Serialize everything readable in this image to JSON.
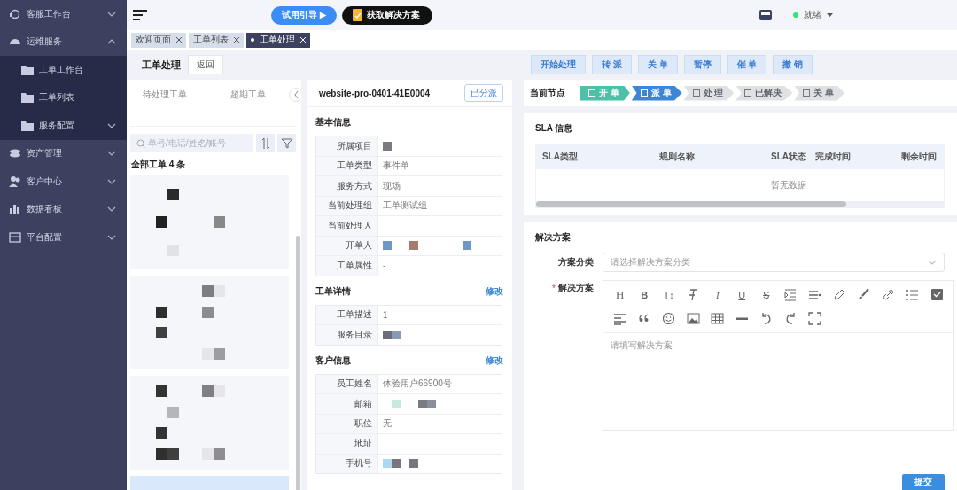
{
  "sidebar": {
    "items": [
      {
        "label": "客服工作台",
        "expanded": false
      },
      {
        "label": "运维服务",
        "expanded": true,
        "children": [
          {
            "label": "工单工作台"
          },
          {
            "label": "工单列表"
          },
          {
            "label": "服务配置",
            "expanded": false
          }
        ]
      },
      {
        "label": "资产管理",
        "expanded": false
      },
      {
        "label": "客户中心",
        "expanded": false
      },
      {
        "label": "数据看板",
        "expanded": false
      },
      {
        "label": "平台配置",
        "expanded": false
      }
    ]
  },
  "topbar": {
    "guide_button": "试用引导 ▶",
    "solution_button": "获取解决方案",
    "status": {
      "label": "就绪",
      "color": "#2ee86f"
    }
  },
  "page_tabs": [
    {
      "label": "欢迎页面",
      "selected": false
    },
    {
      "label": "工单列表",
      "selected": false
    },
    {
      "label": "工单处理",
      "selected": true
    }
  ],
  "page_title": "工单处理",
  "back_button": "返回",
  "ticket_list": {
    "tabs": [
      {
        "label": "待处理工单",
        "selected": false
      },
      {
        "label": "超期工单",
        "selected": false
      }
    ],
    "search": {
      "placeholder": "单号/电话/姓名/账号"
    },
    "count_label": "全部工单 4 条",
    "cards": [
      {
        "selected": false
      },
      {
        "selected": false
      },
      {
        "selected": false
      },
      {
        "selected": true
      }
    ]
  },
  "ticket": {
    "number": "website-pro-0401-41E0004",
    "status_badge": "已分派",
    "sections": [
      {
        "title": "基本信息",
        "fields": [
          {
            "label": "所属项目",
            "redacted": true
          },
          {
            "label": "工单类型",
            "value": "事件单"
          },
          {
            "label": "服务方式",
            "value": "现场"
          },
          {
            "label": "当前处理组",
            "value": "工单测试组"
          },
          {
            "label": "当前处理人"
          },
          {
            "label": "开单人",
            "redacted": true
          },
          {
            "label": "工单属性",
            "value": "-"
          }
        ]
      },
      {
        "title": "工单详情",
        "action": "修改",
        "fields": [
          {
            "label": "工单描述",
            "value": "1"
          },
          {
            "label": "服务目录",
            "redacted": true
          }
        ]
      },
      {
        "title": "客户信息",
        "action": "修改",
        "fields": [
          {
            "label": "员工姓名",
            "value": "体验用户66900号"
          },
          {
            "label": "邮箱",
            "redacted": true
          },
          {
            "label": "职位",
            "value": "无"
          },
          {
            "label": "地址"
          },
          {
            "label": "手机号",
            "redacted": true
          }
        ]
      }
    ]
  },
  "actions": [
    "开始处理",
    "转 派",
    "关 单",
    "暂停",
    "催 单",
    "撤 销"
  ],
  "progress": {
    "label": "当前节点",
    "steps": [
      {
        "label": "开 单",
        "completed": true,
        "active": false
      },
      {
        "label": "派 单",
        "completed": false,
        "active": true
      },
      {
        "label": "处 理",
        "completed": false,
        "active": false
      },
      {
        "label": "已解决",
        "completed": false,
        "active": false
      },
      {
        "label": "关 单",
        "completed": false,
        "active": false
      }
    ]
  },
  "sla": {
    "title": "SLA 信息",
    "columns": [
      "SLA类型",
      "规则名称",
      "SLA状态",
      "完成时间",
      "剩余时间"
    ],
    "empty_text": "暂无数据"
  },
  "solution": {
    "title": "解决方案",
    "category_label": "方案分类",
    "category_placeholder": "请选择解决方案分类",
    "content_label": "解决方案",
    "required_mark": "*",
    "toolbar": [
      {
        "kind": "glyph",
        "text": "H"
      },
      {
        "kind": "glyph",
        "text": "B"
      },
      {
        "kind": "glyph",
        "text": "T↕"
      },
      {
        "kind": "clearformat"
      },
      {
        "kind": "glyph",
        "text": "I"
      },
      {
        "kind": "glyph",
        "text": "U"
      },
      {
        "kind": "glyph",
        "text": "S"
      },
      {
        "kind": "indent"
      },
      {
        "kind": "align"
      },
      {
        "kind": "pencil"
      },
      {
        "kind": "brush"
      },
      {
        "kind": "link"
      },
      {
        "kind": "list"
      },
      {
        "kind": "checkbox"
      },
      {
        "kind": "alignleft"
      },
      {
        "kind": "quote"
      },
      {
        "kind": "emoji"
      },
      {
        "kind": "image"
      },
      {
        "kind": "table"
      },
      {
        "kind": "rule"
      },
      {
        "kind": "undo"
      },
      {
        "kind": "redo"
      },
      {
        "kind": "fullscreen"
      }
    ],
    "editor_placeholder": "请填写解决方案",
    "submit_button": "提交"
  }
}
